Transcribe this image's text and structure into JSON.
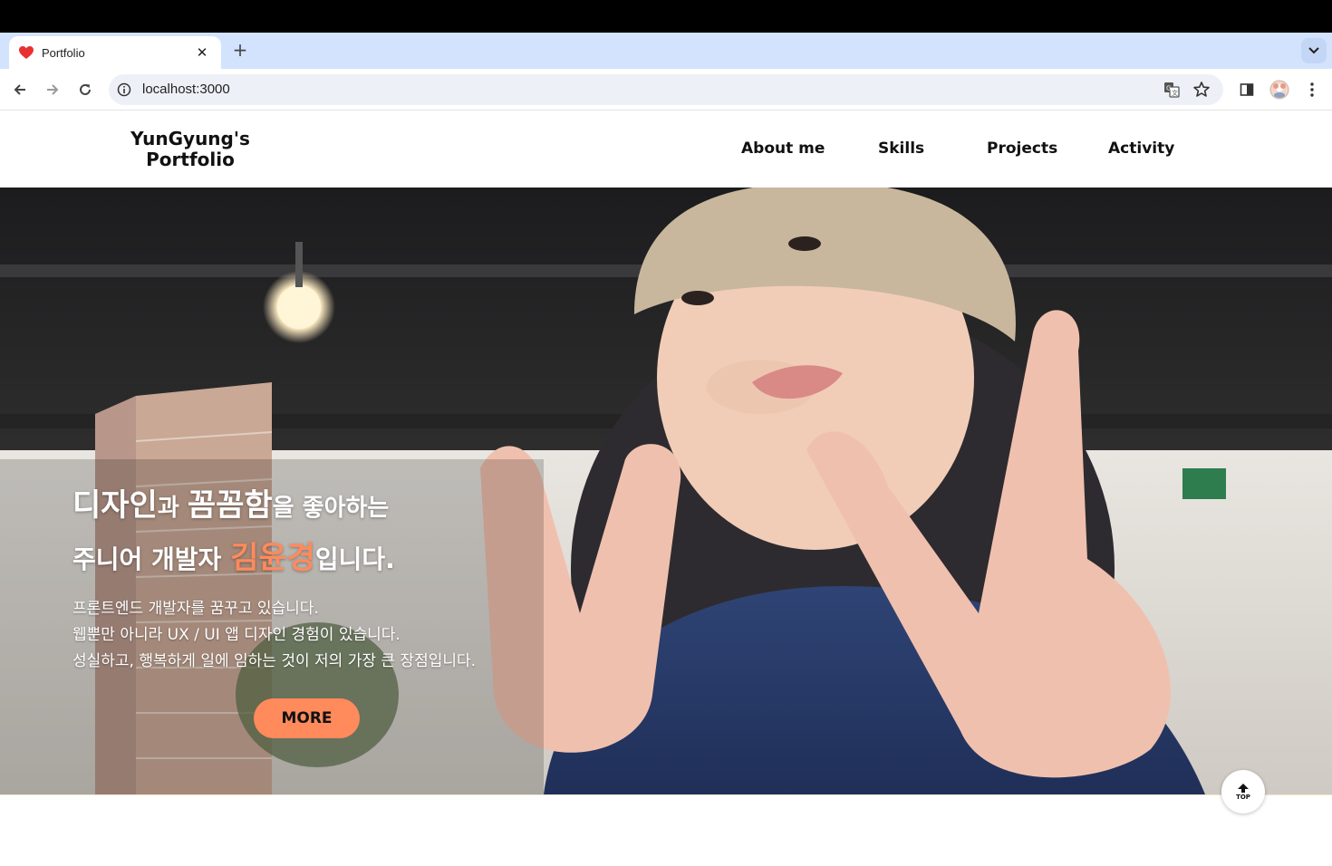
{
  "browser": {
    "tab_title": "Portfolio",
    "url": "localhost:3000"
  },
  "site": {
    "logo_line1": "YunGyung's",
    "logo_line2": "Portfolio",
    "nav": [
      "About me",
      "Skills",
      "Projects",
      "Activity"
    ]
  },
  "hero": {
    "line1_a": "디자인",
    "line1_b": "과 ",
    "line1_c": "꼼꼼함",
    "line1_d": "을 좋아하는",
    "line2_a": "주니어 개발자 ",
    "line2_name": "김윤경",
    "line2_b": "입니다.",
    "desc": [
      "프론트엔드 개발자를 꿈꾸고 있습니다.",
      "웹뿐만 아니라 UX / UI 앱 디자인 경험이 있습니다.",
      "성실하고, 행복하게 일에 임하는 것이 저의 가장 큰 장점입니다."
    ],
    "more_label": "MORE"
  },
  "top_button_label": "TOP",
  "colors": {
    "accent": "#ff8a5c",
    "tabstrip": "#d3e3fd"
  }
}
